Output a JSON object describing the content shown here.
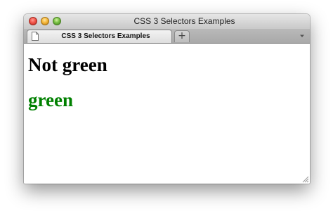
{
  "window": {
    "title": "CSS 3 Selectors Examples"
  },
  "tabs": [
    {
      "label": "CSS 3 Selectors Examples",
      "icon": "page-icon",
      "active": true
    }
  ],
  "toolbar": {
    "new_tab_label": "+",
    "tab_menu_icon": "chevron-down-icon"
  },
  "content": {
    "heading1": "Not green",
    "heading2": "green"
  },
  "colors": {
    "heading1": "#000000",
    "heading2": "#008000"
  }
}
